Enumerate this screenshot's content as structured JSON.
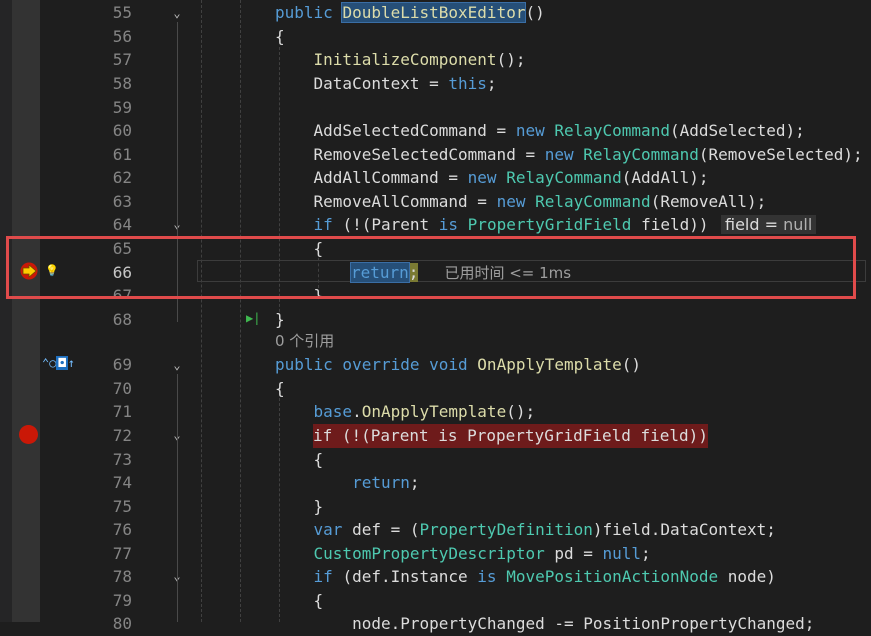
{
  "editor": {
    "lines": [
      {
        "n": "55",
        "code_parts": [
          [
            "kw",
            "public "
          ],
          [
            "sel",
            "DoubleListBoxEditor"
          ],
          [
            "st",
            "()"
          ]
        ]
      },
      {
        "n": "56",
        "code_parts": [
          [
            "st",
            "{"
          ]
        ]
      },
      {
        "n": "57",
        "code_parts": [
          [
            "st",
            "    "
          ],
          [
            "mt",
            "InitializeComponent"
          ],
          [
            "st",
            "();"
          ]
        ]
      },
      {
        "n": "58",
        "code_parts": [
          [
            "st",
            "    DataContext = "
          ],
          [
            "kw",
            "this"
          ],
          [
            "st",
            ";"
          ]
        ]
      },
      {
        "n": "59",
        "code_parts": []
      },
      {
        "n": "60",
        "code_parts": [
          [
            "st",
            "    AddSelectedCommand = "
          ],
          [
            "kw",
            "new "
          ],
          [
            "ty",
            "RelayCommand"
          ],
          [
            "st",
            "(AddSelected);"
          ]
        ]
      },
      {
        "n": "61",
        "code_parts": [
          [
            "st",
            "    RemoveSelectedCommand = "
          ],
          [
            "kw",
            "new "
          ],
          [
            "ty",
            "RelayCommand"
          ],
          [
            "st",
            "(RemoveSelected);"
          ]
        ]
      },
      {
        "n": "62",
        "code_parts": [
          [
            "st",
            "    AddAllCommand = "
          ],
          [
            "kw",
            "new "
          ],
          [
            "ty",
            "RelayCommand"
          ],
          [
            "st",
            "(AddAll);"
          ]
        ]
      },
      {
        "n": "63",
        "code_parts": [
          [
            "st",
            "    RemoveAllCommand = "
          ],
          [
            "kw",
            "new "
          ],
          [
            "ty",
            "RelayCommand"
          ],
          [
            "st",
            "(RemoveAll);"
          ]
        ]
      },
      {
        "n": "64",
        "code_parts": [
          [
            "st",
            "    "
          ],
          [
            "kw",
            "if "
          ],
          [
            "st",
            "(!(Parent "
          ],
          [
            "kw",
            "is "
          ],
          [
            "ty",
            "PropertyGridField"
          ],
          [
            "st",
            " field))"
          ]
        ]
      },
      {
        "n": "65",
        "code_parts": [
          [
            "st",
            "    {"
          ]
        ]
      },
      {
        "n": "66",
        "code_parts": [
          [
            "st",
            "        "
          ]
        ]
      },
      {
        "n": "67",
        "code_parts": [
          [
            "st",
            "    }"
          ]
        ]
      },
      {
        "n": "68",
        "code_parts": [
          [
            "st",
            "}"
          ]
        ]
      },
      {
        "n": "69",
        "code_parts": [
          [
            "kw",
            "public override void "
          ],
          [
            "mt",
            "OnApplyTemplate"
          ],
          [
            "st",
            "()"
          ]
        ]
      },
      {
        "n": "70",
        "code_parts": [
          [
            "st",
            "{"
          ]
        ]
      },
      {
        "n": "71",
        "code_parts": [
          [
            "st",
            "    "
          ],
          [
            "kw",
            "base"
          ],
          [
            "st",
            "."
          ],
          [
            "mt",
            "OnApplyTemplate"
          ],
          [
            "st",
            "();"
          ]
        ]
      },
      {
        "n": "72",
        "code_parts": [
          [
            "st",
            "    if (!(Parent is PropertyGridField field))"
          ]
        ]
      },
      {
        "n": "73",
        "code_parts": [
          [
            "st",
            "    {"
          ]
        ]
      },
      {
        "n": "74",
        "code_parts": [
          [
            "st",
            "        "
          ],
          [
            "kw",
            "return"
          ],
          [
            "st",
            ";"
          ]
        ]
      },
      {
        "n": "75",
        "code_parts": [
          [
            "st",
            "    }"
          ]
        ]
      },
      {
        "n": "76",
        "code_parts": [
          [
            "st",
            "    "
          ],
          [
            "kw",
            "var "
          ],
          [
            "st",
            "def = ("
          ],
          [
            "ty",
            "PropertyDefinition"
          ],
          [
            "st",
            ")field.DataContext;"
          ]
        ]
      },
      {
        "n": "77",
        "code_parts": [
          [
            "st",
            "    "
          ],
          [
            "ty",
            "CustomPropertyDescriptor"
          ],
          [
            "st",
            " pd = "
          ],
          [
            "kw",
            "null"
          ],
          [
            "st",
            ";"
          ]
        ]
      },
      {
        "n": "78",
        "code_parts": [
          [
            "st",
            "    "
          ],
          [
            "kw",
            "if "
          ],
          [
            "st",
            "(def.Instance "
          ],
          [
            "kw",
            "is "
          ],
          [
            "ty",
            "MovePositionActionNode"
          ],
          [
            "st",
            " node)"
          ]
        ]
      },
      {
        "n": "79",
        "code_parts": [
          [
            "st",
            "    {"
          ]
        ]
      },
      {
        "n": "80",
        "code_parts": [
          [
            "st",
            "        node.PropertyChanged -= PositionPropertyChanged;"
          ]
        ]
      }
    ],
    "inline_value_name": "field",
    "inline_value_op": " = ",
    "inline_value_val": "null",
    "return_kw": "return",
    "return_semicolon": ";",
    "elapsed_hint": "已用时间 <= 1ms",
    "codelens_refs": "0 个引用"
  }
}
